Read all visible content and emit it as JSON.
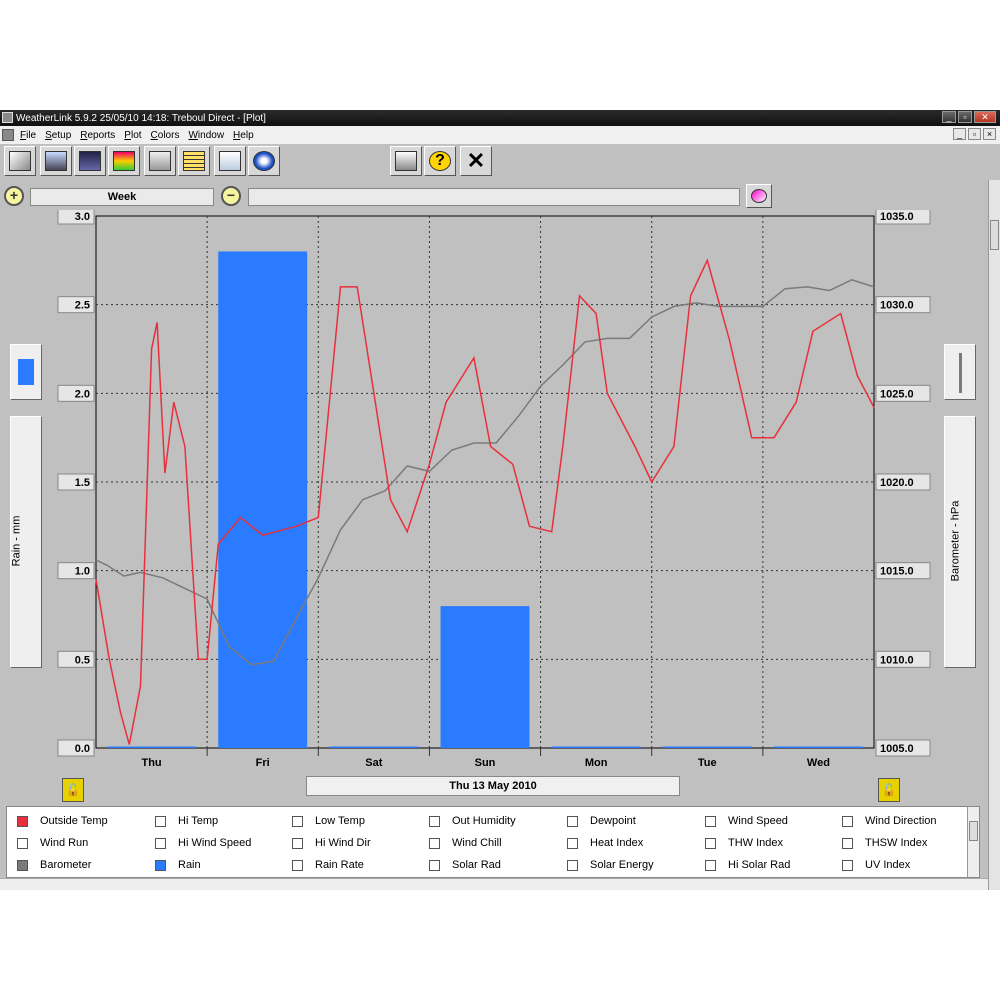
{
  "window": {
    "title": "WeatherLink 5.9.2  25/05/10  14:18: Treboul Direct - [Plot]"
  },
  "menu": [
    "File",
    "Setup",
    "Reports",
    "Plot",
    "Colors",
    "Window",
    "Help"
  ],
  "toolbar": {
    "icons": [
      "station-select-icon",
      "connect-icon",
      "bulletin-icon",
      "summary-icon",
      "browse-icon",
      "notes-icon",
      "weather-icon",
      "noaa-icon"
    ],
    "print_icon": "printer-icon",
    "help_icon": "help-icon",
    "close_icon": "close-icon"
  },
  "plot_toolbar": {
    "range": "Week",
    "zoom_in": "+",
    "zoom_out": "−"
  },
  "axes": {
    "left_label": "Rain - mm",
    "right_label": "Barometer - hPa",
    "left_ticks": [
      "3.0",
      "2.5",
      "2.0",
      "1.5",
      "1.0",
      "0.5",
      "0.0"
    ],
    "right_ticks": [
      "1035.0",
      "1030.0",
      "1025.0",
      "1020.0",
      "1015.0",
      "1010.0",
      "1005.0"
    ]
  },
  "date_label": "Thu 13 May 2010",
  "legend": {
    "items": [
      {
        "label": "Outside Temp",
        "color": "#e8303c",
        "checked": true
      },
      {
        "label": "Hi Temp",
        "checked": false
      },
      {
        "label": "Low Temp",
        "checked": false
      },
      {
        "label": "Out Humidity",
        "checked": false
      },
      {
        "label": "Dewpoint",
        "checked": false
      },
      {
        "label": "Wind Speed",
        "checked": false
      },
      {
        "label": "Wind Direction",
        "checked": false
      },
      {
        "label": "Wind Run",
        "checked": false
      },
      {
        "label": "Hi Wind Speed",
        "checked": false
      },
      {
        "label": "Hi Wind Dir",
        "checked": false
      },
      {
        "label": "Wind Chill",
        "checked": false
      },
      {
        "label": "Heat Index",
        "checked": false
      },
      {
        "label": "THW Index",
        "checked": false
      },
      {
        "label": "THSW Index",
        "checked": false
      },
      {
        "label": "Barometer",
        "color": "#7a7a7a",
        "checked": true
      },
      {
        "label": "Rain",
        "color": "#2a7bff",
        "checked": true
      },
      {
        "label": "Rain Rate",
        "checked": false
      },
      {
        "label": "Solar Rad",
        "checked": false
      },
      {
        "label": "Solar Energy",
        "checked": false
      },
      {
        "label": "Hi Solar Rad",
        "checked": false
      },
      {
        "label": "UV Index",
        "checked": false
      }
    ]
  },
  "chart_data": {
    "type": "bar",
    "categories": [
      "Thu",
      "Fri",
      "Sat",
      "Sun",
      "Mon",
      "Tue",
      "Wed"
    ],
    "grid": true,
    "left_axis": {
      "label": "Rain - mm",
      "range": [
        0,
        3.0
      ]
    },
    "right_axis": {
      "label": "Barometer - hPa",
      "range": [
        1005.0,
        1035.0
      ]
    },
    "series": [
      {
        "name": "Rain",
        "axis": "left",
        "type": "bar",
        "color": "#2a7bff",
        "values": [
          0.0,
          2.8,
          0.0,
          0.8,
          0.0,
          0.0,
          0.0
        ]
      },
      {
        "name": "Barometer",
        "axis": "right",
        "type": "line",
        "color": "#7a7a7a",
        "x": [
          0,
          0.1,
          0.25,
          0.4,
          0.6,
          0.8,
          1.0,
          1.2,
          1.4,
          1.6,
          1.8,
          2.0,
          2.2,
          2.4,
          2.6,
          2.8,
          3.0,
          3.2,
          3.4,
          3.6,
          3.8,
          4.0,
          4.2,
          4.4,
          4.6,
          4.8,
          5.0,
          5.2,
          5.4,
          5.6,
          5.8,
          6.0,
          6.2,
          6.4,
          6.6,
          6.8,
          7.0
        ],
        "values": [
          1015.6,
          1015.3,
          1014.7,
          1014.9,
          1014.6,
          1014.0,
          1013.4,
          1010.7,
          1009.7,
          1009.9,
          1012.3,
          1014.6,
          1017.3,
          1019.0,
          1019.5,
          1020.9,
          1020.6,
          1021.8,
          1022.2,
          1022.2,
          1023.7,
          1025.4,
          1026.6,
          1027.9,
          1028.1,
          1028.1,
          1029.3,
          1029.9,
          1030.1,
          1029.9,
          1029.9,
          1029.9,
          1030.9,
          1031.0,
          1030.8,
          1031.4,
          1031.0
        ]
      },
      {
        "name": "Outside Temp",
        "axis": "left",
        "type": "line",
        "color": "#e8303c",
        "x": [
          0,
          0.12,
          0.22,
          0.3,
          0.4,
          0.5,
          0.55,
          0.62,
          0.7,
          0.8,
          0.92,
          1.0,
          1.1,
          1.3,
          1.5,
          1.8,
          2.0,
          2.2,
          2.35,
          2.5,
          2.65,
          2.8,
          3.0,
          3.15,
          3.4,
          3.55,
          3.75,
          3.9,
          4.1,
          4.2,
          4.35,
          4.5,
          4.6,
          4.85,
          5.0,
          5.2,
          5.35,
          5.5,
          5.7,
          5.9,
          6.1,
          6.3,
          6.45,
          6.7,
          6.85,
          7.0
        ],
        "values": [
          0.95,
          0.5,
          0.2,
          0.02,
          0.35,
          2.25,
          2.4,
          1.55,
          1.95,
          1.7,
          0.5,
          0.5,
          1.15,
          1.3,
          1.2,
          1.25,
          1.3,
          2.6,
          2.6,
          2.0,
          1.4,
          1.22,
          1.6,
          1.95,
          2.2,
          1.7,
          1.6,
          1.25,
          1.22,
          1.7,
          2.55,
          2.45,
          2.0,
          1.7,
          1.5,
          1.7,
          2.55,
          2.75,
          2.3,
          1.75,
          1.75,
          1.95,
          2.35,
          2.45,
          2.1,
          1.92
        ]
      }
    ]
  }
}
